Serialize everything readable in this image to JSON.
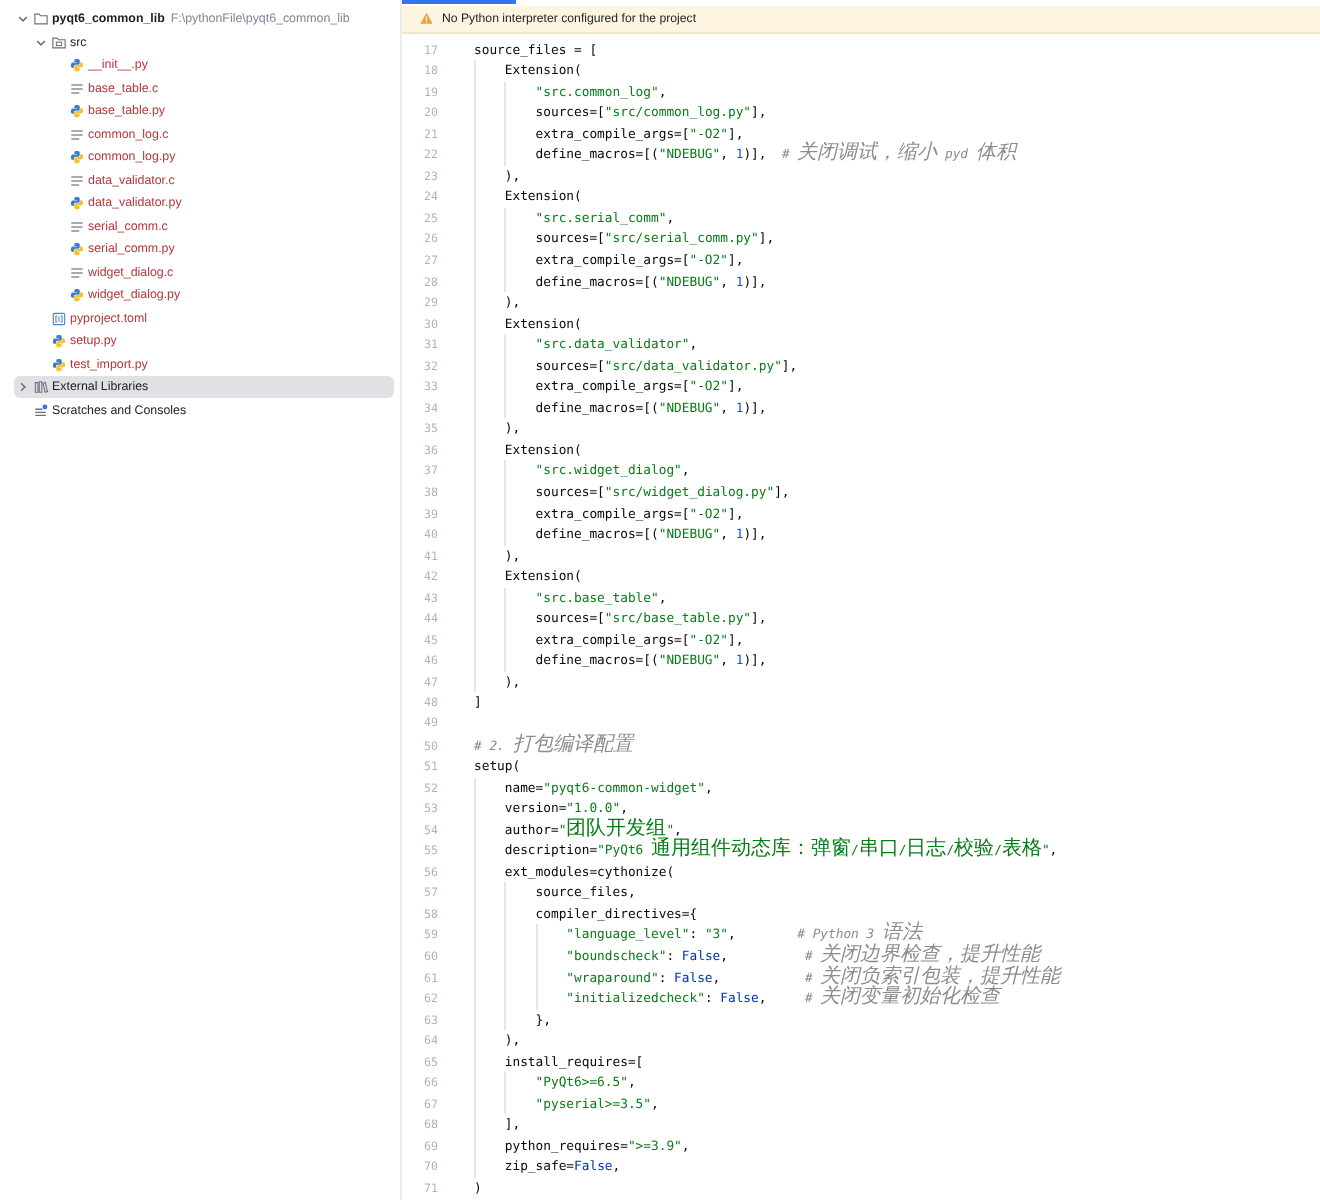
{
  "project_tree": {
    "items": [
      {
        "name": "pyqt6_common_lib",
        "path": "F:\\pythonFile\\pyqt6_common_lib",
        "kind": "project",
        "expanded": true,
        "selected": false,
        "unversioned": false,
        "children": [
          {
            "name": "src",
            "kind": "source_folder",
            "expanded": true,
            "selected": false,
            "unversioned": false,
            "children": [
              {
                "name": "__init__.py",
                "kind": "python",
                "selected": false,
                "unversioned": true
              },
              {
                "name": "base_table.c",
                "kind": "c_source",
                "selected": false,
                "unversioned": true
              },
              {
                "name": "base_table.py",
                "kind": "python",
                "selected": false,
                "unversioned": true
              },
              {
                "name": "common_log.c",
                "kind": "c_source",
                "selected": false,
                "unversioned": true
              },
              {
                "name": "common_log.py",
                "kind": "python",
                "selected": false,
                "unversioned": true
              },
              {
                "name": "data_validator.c",
                "kind": "c_source",
                "selected": false,
                "unversioned": true
              },
              {
                "name": "data_validator.py",
                "kind": "python",
                "selected": false,
                "unversioned": true
              },
              {
                "name": "serial_comm.c",
                "kind": "c_source",
                "selected": false,
                "unversioned": true
              },
              {
                "name": "serial_comm.py",
                "kind": "python",
                "selected": false,
                "unversioned": true
              },
              {
                "name": "widget_dialog.c",
                "kind": "c_source",
                "selected": false,
                "unversioned": true
              },
              {
                "name": "widget_dialog.py",
                "kind": "python",
                "selected": false,
                "unversioned": true
              }
            ]
          },
          {
            "name": "pyproject.toml",
            "kind": "toml",
            "selected": false,
            "unversioned": true
          },
          {
            "name": "setup.py",
            "kind": "python",
            "selected": false,
            "unversioned": true
          },
          {
            "name": "test_import.py",
            "kind": "python",
            "selected": false,
            "unversioned": true
          }
        ]
      },
      {
        "name": "External Libraries",
        "kind": "libraries",
        "expanded": false,
        "selected": true,
        "unversioned": false
      },
      {
        "name": "Scratches and Consoles",
        "kind": "scratches",
        "selected": false,
        "unversioned": false
      }
    ]
  },
  "editor": {
    "banner": {
      "message": "No Python interpreter configured for the project"
    },
    "lines": [
      {
        "number": "17",
        "segments": [
          {
            "kind": "plain",
            "text": "source_files = ["
          }
        ]
      },
      {
        "number": "18",
        "segments": [
          {
            "kind": "plain",
            "text": "    Extension("
          }
        ]
      },
      {
        "number": "19",
        "segments": [
          {
            "kind": "string",
            "text": "        \"src.common_log\""
          },
          {
            "kind": "plain",
            "text": ","
          }
        ]
      },
      {
        "number": "20",
        "segments": [
          {
            "kind": "plain",
            "text": "        sources=["
          },
          {
            "kind": "string",
            "text": "\"src/common_log.py\""
          },
          {
            "kind": "plain",
            "text": "],"
          }
        ]
      },
      {
        "number": "21",
        "segments": [
          {
            "kind": "plain",
            "text": "        extra_compile_args=["
          },
          {
            "kind": "string",
            "text": "\"-O2\""
          },
          {
            "kind": "plain",
            "text": "],"
          }
        ]
      },
      {
        "number": "22",
        "segments": [
          {
            "kind": "plain",
            "text": "        define_macros=[("
          },
          {
            "kind": "string",
            "text": "\"NDEBUG\""
          },
          {
            "kind": "plain",
            "text": ", "
          },
          {
            "kind": "number",
            "text": "1"
          },
          {
            "kind": "plain",
            "text": ")],  "
          },
          {
            "kind": "comment",
            "text": "# 关闭调试，缩小 pyd 体积"
          }
        ]
      },
      {
        "number": "23",
        "segments": [
          {
            "kind": "plain",
            "text": "    ),"
          }
        ]
      },
      {
        "number": "24",
        "segments": [
          {
            "kind": "plain",
            "text": "    Extension("
          }
        ]
      },
      {
        "number": "25",
        "segments": [
          {
            "kind": "string",
            "text": "        \"src.serial_comm\""
          },
          {
            "kind": "plain",
            "text": ","
          }
        ]
      },
      {
        "number": "26",
        "segments": [
          {
            "kind": "plain",
            "text": "        sources=["
          },
          {
            "kind": "string",
            "text": "\"src/serial_comm.py\""
          },
          {
            "kind": "plain",
            "text": "],"
          }
        ]
      },
      {
        "number": "27",
        "segments": [
          {
            "kind": "plain",
            "text": "        extra_compile_args=["
          },
          {
            "kind": "string",
            "text": "\"-O2\""
          },
          {
            "kind": "plain",
            "text": "],"
          }
        ]
      },
      {
        "number": "28",
        "segments": [
          {
            "kind": "plain",
            "text": "        define_macros=[("
          },
          {
            "kind": "string",
            "text": "\"NDEBUG\""
          },
          {
            "kind": "plain",
            "text": ", "
          },
          {
            "kind": "number",
            "text": "1"
          },
          {
            "kind": "plain",
            "text": ")],"
          }
        ]
      },
      {
        "number": "29",
        "segments": [
          {
            "kind": "plain",
            "text": "    ),"
          }
        ]
      },
      {
        "number": "30",
        "segments": [
          {
            "kind": "plain",
            "text": "    Extension("
          }
        ]
      },
      {
        "number": "31",
        "segments": [
          {
            "kind": "string",
            "text": "        \"src.data_validator\""
          },
          {
            "kind": "plain",
            "text": ","
          }
        ]
      },
      {
        "number": "32",
        "segments": [
          {
            "kind": "plain",
            "text": "        sources=["
          },
          {
            "kind": "string",
            "text": "\"src/data_validator.py\""
          },
          {
            "kind": "plain",
            "text": "],"
          }
        ]
      },
      {
        "number": "33",
        "segments": [
          {
            "kind": "plain",
            "text": "        extra_compile_args=["
          },
          {
            "kind": "string",
            "text": "\"-O2\""
          },
          {
            "kind": "plain",
            "text": "],"
          }
        ]
      },
      {
        "number": "34",
        "segments": [
          {
            "kind": "plain",
            "text": "        define_macros=[("
          },
          {
            "kind": "string",
            "text": "\"NDEBUG\""
          },
          {
            "kind": "plain",
            "text": ", "
          },
          {
            "kind": "number",
            "text": "1"
          },
          {
            "kind": "plain",
            "text": ")],"
          }
        ]
      },
      {
        "number": "35",
        "segments": [
          {
            "kind": "plain",
            "text": "    ),"
          }
        ]
      },
      {
        "number": "36",
        "segments": [
          {
            "kind": "plain",
            "text": "    Extension("
          }
        ]
      },
      {
        "number": "37",
        "segments": [
          {
            "kind": "string",
            "text": "        \"src.widget_dialog\""
          },
          {
            "kind": "plain",
            "text": ","
          }
        ]
      },
      {
        "number": "38",
        "segments": [
          {
            "kind": "plain",
            "text": "        sources=["
          },
          {
            "kind": "string",
            "text": "\"src/widget_dialog.py\""
          },
          {
            "kind": "plain",
            "text": "],"
          }
        ]
      },
      {
        "number": "39",
        "segments": [
          {
            "kind": "plain",
            "text": "        extra_compile_args=["
          },
          {
            "kind": "string",
            "text": "\"-O2\""
          },
          {
            "kind": "plain",
            "text": "],"
          }
        ]
      },
      {
        "number": "40",
        "segments": [
          {
            "kind": "plain",
            "text": "        define_macros=[("
          },
          {
            "kind": "string",
            "text": "\"NDEBUG\""
          },
          {
            "kind": "plain",
            "text": ", "
          },
          {
            "kind": "number",
            "text": "1"
          },
          {
            "kind": "plain",
            "text": ")],"
          }
        ]
      },
      {
        "number": "41",
        "segments": [
          {
            "kind": "plain",
            "text": "    ),"
          }
        ]
      },
      {
        "number": "42",
        "segments": [
          {
            "kind": "plain",
            "text": "    Extension("
          }
        ]
      },
      {
        "number": "43",
        "segments": [
          {
            "kind": "string",
            "text": "        \"src.base_table\""
          },
          {
            "kind": "plain",
            "text": ","
          }
        ]
      },
      {
        "number": "44",
        "segments": [
          {
            "kind": "plain",
            "text": "        sources=["
          },
          {
            "kind": "string",
            "text": "\"src/base_table.py\""
          },
          {
            "kind": "plain",
            "text": "],"
          }
        ]
      },
      {
        "number": "45",
        "segments": [
          {
            "kind": "plain",
            "text": "        extra_compile_args=["
          },
          {
            "kind": "string",
            "text": "\"-O2\""
          },
          {
            "kind": "plain",
            "text": "],"
          }
        ]
      },
      {
        "number": "46",
        "segments": [
          {
            "kind": "plain",
            "text": "        define_macros=[("
          },
          {
            "kind": "string",
            "text": "\"NDEBUG\""
          },
          {
            "kind": "plain",
            "text": ", "
          },
          {
            "kind": "number",
            "text": "1"
          },
          {
            "kind": "plain",
            "text": ")],"
          }
        ]
      },
      {
        "number": "47",
        "segments": [
          {
            "kind": "plain",
            "text": "    ),"
          }
        ]
      },
      {
        "number": "48",
        "segments": [
          {
            "kind": "plain",
            "text": "]"
          }
        ]
      },
      {
        "number": "49"
      },
      {
        "number": "50",
        "segments": [
          {
            "kind": "comment",
            "text": "# 2. 打包编译配置"
          }
        ]
      },
      {
        "number": "51",
        "segments": [
          {
            "kind": "plain",
            "text": "setup("
          }
        ]
      },
      {
        "number": "52",
        "segments": [
          {
            "kind": "plain",
            "text": "    name="
          },
          {
            "kind": "string",
            "text": "\"pyqt6-common-widget\""
          },
          {
            "kind": "plain",
            "text": ","
          }
        ]
      },
      {
        "number": "53",
        "segments": [
          {
            "kind": "plain",
            "text": "    version="
          },
          {
            "kind": "string",
            "text": "\"1.0.0\""
          },
          {
            "kind": "plain",
            "text": ","
          }
        ]
      },
      {
        "number": "54",
        "segments": [
          {
            "kind": "plain",
            "text": "    author="
          },
          {
            "kind": "string",
            "text": "\"团队开发组\""
          },
          {
            "kind": "plain",
            "text": ","
          }
        ]
      },
      {
        "number": "55",
        "segments": [
          {
            "kind": "plain",
            "text": "    description="
          },
          {
            "kind": "string",
            "text": "\"PyQt6 通用组件动态库：弹窗/串口/日志/校验/表格\""
          },
          {
            "kind": "plain",
            "text": ","
          }
        ]
      },
      {
        "number": "56",
        "segments": [
          {
            "kind": "plain",
            "text": "    ext_modules=cythonize("
          }
        ]
      },
      {
        "number": "57",
        "segments": [
          {
            "kind": "plain",
            "text": "        source_files,"
          }
        ]
      },
      {
        "number": "58",
        "segments": [
          {
            "kind": "plain",
            "text": "        compiler_directives={"
          }
        ]
      },
      {
        "number": "59",
        "segments": [
          {
            "kind": "string",
            "text": "            \"language_level\""
          },
          {
            "kind": "plain",
            "text": ": "
          },
          {
            "kind": "string",
            "text": "\"3\""
          },
          {
            "kind": "plain",
            "text": ",        "
          },
          {
            "kind": "comment",
            "text": "# Python 3 语法"
          }
        ]
      },
      {
        "number": "60",
        "segments": [
          {
            "kind": "string",
            "text": "            \"boundscheck\""
          },
          {
            "kind": "plain",
            "text": ": "
          },
          {
            "kind": "keyword",
            "text": "False"
          },
          {
            "kind": "plain",
            "text": ",          "
          },
          {
            "kind": "comment",
            "text": "# 关闭边界检查，提升性能"
          }
        ]
      },
      {
        "number": "61",
        "segments": [
          {
            "kind": "string",
            "text": "            \"wraparound\""
          },
          {
            "kind": "plain",
            "text": ": "
          },
          {
            "kind": "keyword",
            "text": "False"
          },
          {
            "kind": "plain",
            "text": ",           "
          },
          {
            "kind": "comment",
            "text": "# 关闭负索引包装，提升性能"
          }
        ]
      },
      {
        "number": "62",
        "segments": [
          {
            "kind": "string",
            "text": "            \"initializedcheck\""
          },
          {
            "kind": "plain",
            "text": ": "
          },
          {
            "kind": "keyword",
            "text": "False"
          },
          {
            "kind": "plain",
            "text": ",     "
          },
          {
            "kind": "comment",
            "text": "# 关闭变量初始化检查"
          }
        ]
      },
      {
        "number": "63",
        "segments": [
          {
            "kind": "plain",
            "text": "        },"
          }
        ]
      },
      {
        "number": "64",
        "segments": [
          {
            "kind": "plain",
            "text": "    ),"
          }
        ]
      },
      {
        "number": "65",
        "segments": [
          {
            "kind": "plain",
            "text": "    install_requires=["
          }
        ]
      },
      {
        "number": "66",
        "segments": [
          {
            "kind": "string",
            "text": "        \"PyQt6>=6.5\""
          },
          {
            "kind": "plain",
            "text": ","
          }
        ]
      },
      {
        "number": "67",
        "segments": [
          {
            "kind": "string",
            "text": "        \"pyserial>=3.5\""
          },
          {
            "kind": "plain",
            "text": ","
          }
        ]
      },
      {
        "number": "68",
        "segments": [
          {
            "kind": "plain",
            "text": "    ],"
          }
        ]
      },
      {
        "number": "69",
        "segments": [
          {
            "kind": "plain",
            "text": "    python_requires="
          },
          {
            "kind": "string",
            "text": "\">=3.9\""
          },
          {
            "kind": "plain",
            "text": ","
          }
        ]
      },
      {
        "number": "70",
        "segments": [
          {
            "kind": "plain",
            "text": "    zip_safe="
          },
          {
            "kind": "keyword",
            "text": "False"
          },
          {
            "kind": "plain",
            "text": ","
          }
        ]
      },
      {
        "number": "71",
        "segments": [
          {
            "kind": "plain",
            "text": ")"
          }
        ]
      }
    ]
  }
}
